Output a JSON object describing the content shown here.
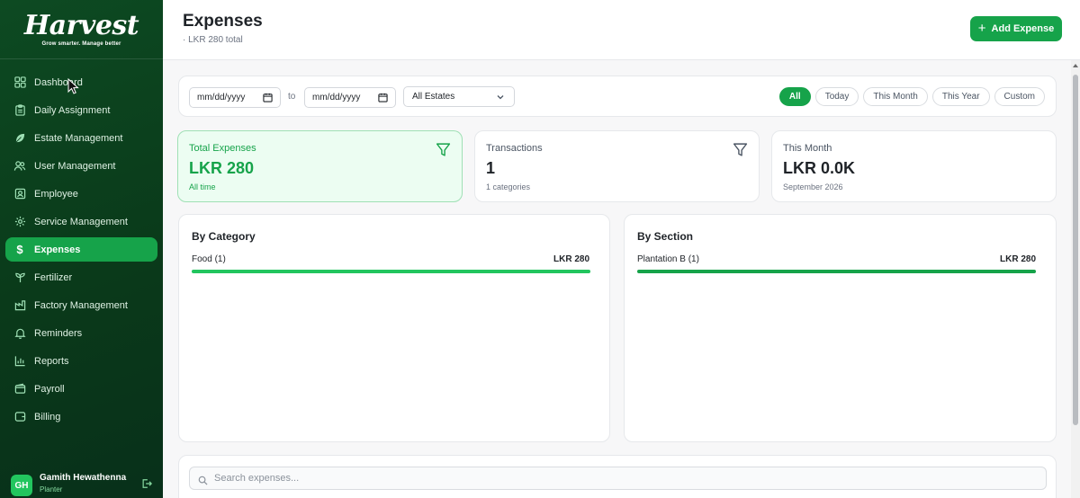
{
  "brand": {
    "name": "Harvest",
    "tagline": "Grow smarter. Manage better",
    "accent": "#16a34a",
    "sidebar_bg": "#0b3d1d"
  },
  "sidebar": {
    "items": [
      {
        "label": "Dashboard",
        "icon": "grid-icon"
      },
      {
        "label": "Daily Assignment",
        "icon": "clipboard-icon"
      },
      {
        "label": "Estate Management",
        "icon": "leaf-icon"
      },
      {
        "label": "User Management",
        "icon": "users-icon"
      },
      {
        "label": "Employee",
        "icon": "id-badge-icon"
      },
      {
        "label": "Service Management",
        "icon": "gear-icon"
      },
      {
        "label": "Expenses",
        "icon": "dollar-icon",
        "active": true
      },
      {
        "label": "Fertilizer",
        "icon": "sprout-icon"
      },
      {
        "label": "Factory Management",
        "icon": "factory-icon"
      },
      {
        "label": "Reminders",
        "icon": "bell-icon"
      },
      {
        "label": "Reports",
        "icon": "bar-chart-icon"
      },
      {
        "label": "Payroll",
        "icon": "wallet-icon"
      },
      {
        "label": "Billing",
        "icon": "receipt-icon"
      }
    ],
    "user": {
      "initials": "GH",
      "name": "Gamith Hewathenna",
      "role": "Planter"
    }
  },
  "header": {
    "title": "Expenses",
    "subtitle": "· LKR 280 total",
    "add_label": "Add Expense"
  },
  "filters": {
    "from_placeholder": "mm/dd/yyyy",
    "to_label": "to",
    "to_placeholder": "mm/dd/yyyy",
    "estate": "All Estates",
    "ranges": [
      {
        "label": "All",
        "active": true
      },
      {
        "label": "Today"
      },
      {
        "label": "This Month"
      },
      {
        "label": "This Year"
      },
      {
        "label": "Custom"
      }
    ]
  },
  "stats": [
    {
      "label": "Total Expenses",
      "value": "LKR 280",
      "note": "All time"
    },
    {
      "label": "Transactions",
      "value": "1",
      "note": "1 categories"
    },
    {
      "label": "This Month",
      "value": "LKR 0.0K",
      "note": "September 2026"
    }
  ],
  "by_category": {
    "title": "By Category",
    "rows": [
      {
        "label": "Food (1)",
        "value": "LKR 280",
        "fraction": 1.0,
        "color": "#22c55e"
      }
    ]
  },
  "by_section": {
    "title": "By Section",
    "rows": [
      {
        "label": "Plantation B (1)",
        "value": "LKR 280",
        "fraction": 1.0,
        "color": "#16a34a"
      }
    ]
  },
  "search": {
    "placeholder": "Search expenses..."
  }
}
